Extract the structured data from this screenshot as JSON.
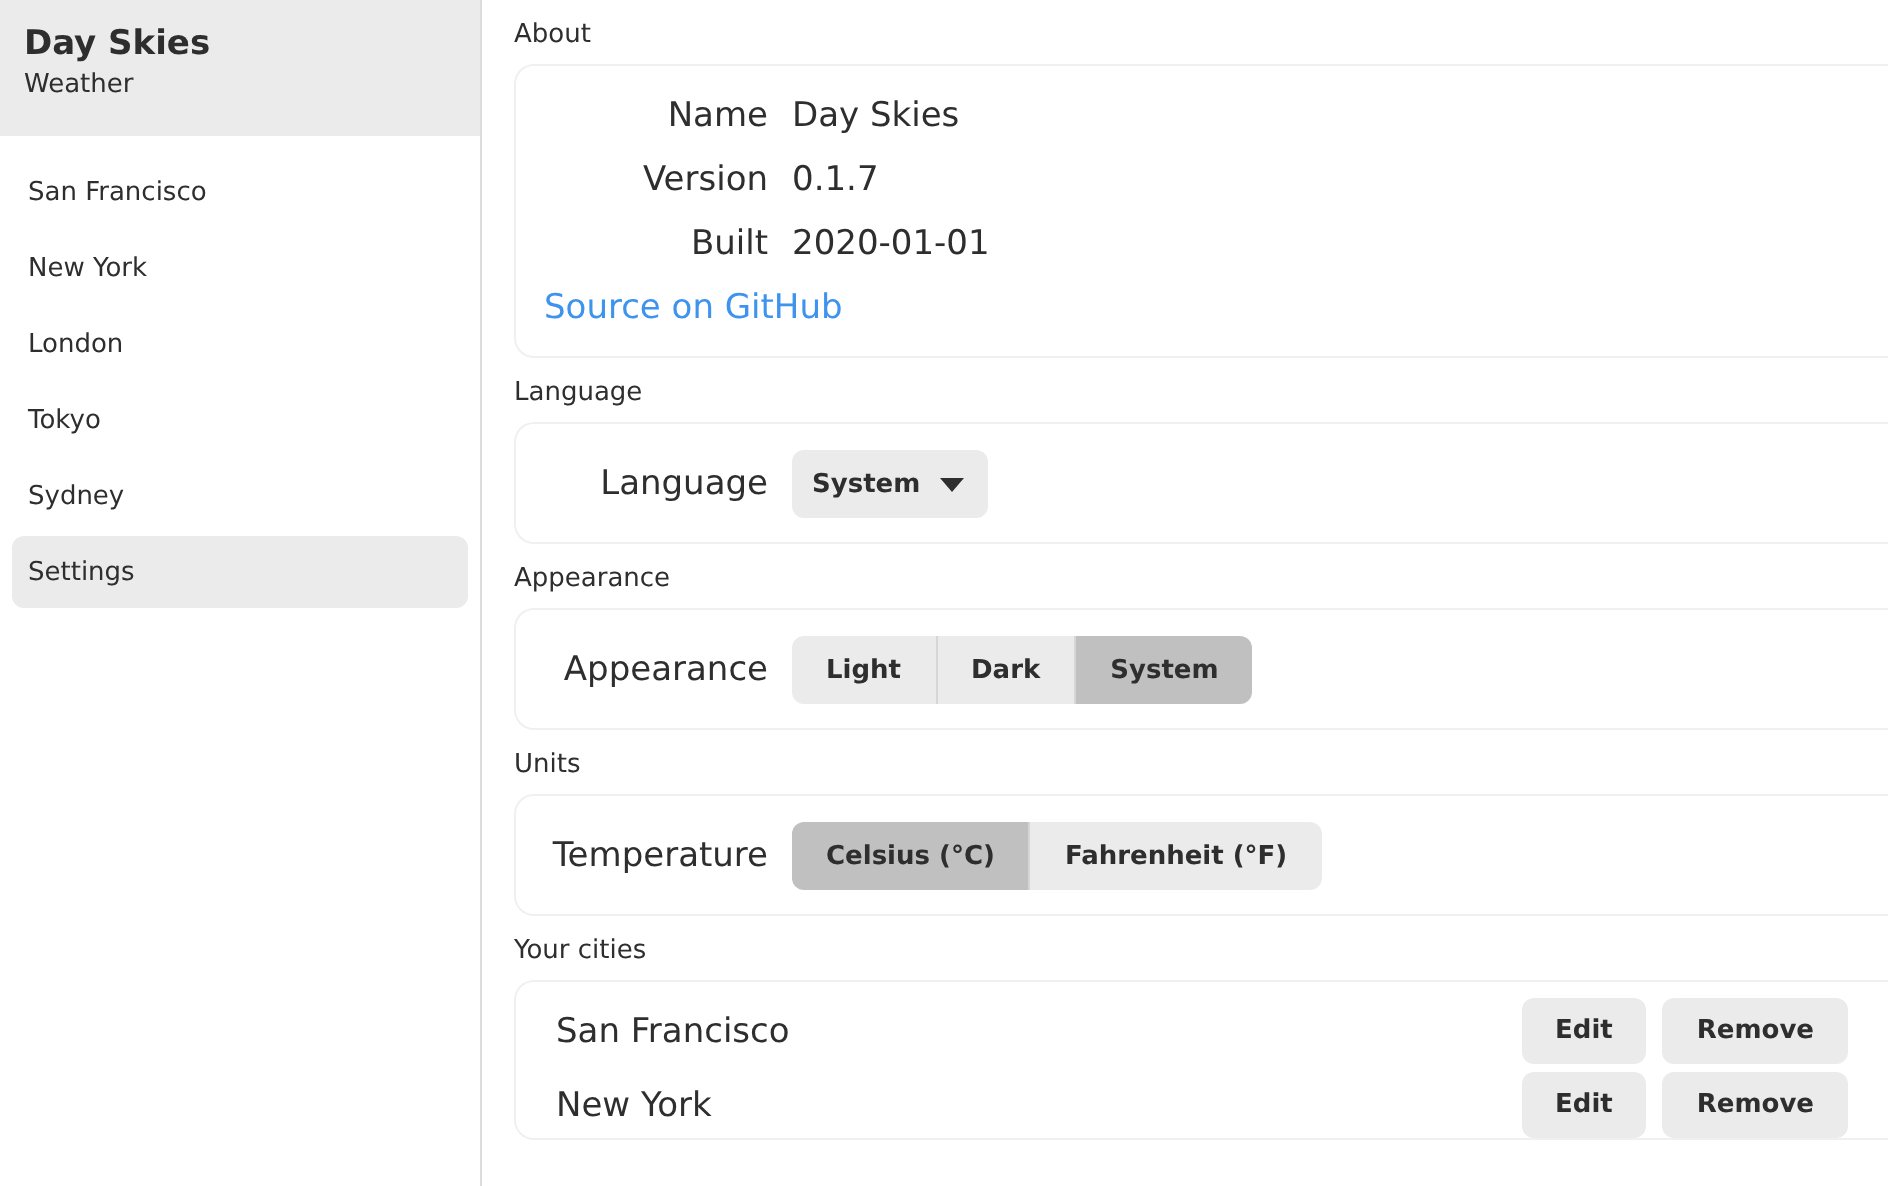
{
  "app": {
    "title": "Day Skies",
    "subtitle": "Weather"
  },
  "sidebar": {
    "items": [
      {
        "label": "San Francisco",
        "selected": false
      },
      {
        "label": "New York",
        "selected": false
      },
      {
        "label": "London",
        "selected": false
      },
      {
        "label": "Tokyo",
        "selected": false
      },
      {
        "label": "Sydney",
        "selected": false
      },
      {
        "label": "Settings",
        "selected": true
      }
    ]
  },
  "sections": [
    {
      "kind": "about",
      "title": "About",
      "rows": [
        {
          "label": "Name",
          "value": "Day Skies"
        },
        {
          "label": "Version",
          "value": "0.1.7"
        },
        {
          "label": "Built",
          "value": "2020-01-01"
        }
      ],
      "link": "Source on GitHub"
    },
    {
      "kind": "dropdown",
      "title": "Language",
      "label": "Language",
      "value": "System"
    },
    {
      "kind": "segmented",
      "title": "Appearance",
      "label": "Appearance",
      "options": [
        {
          "label": "Light",
          "selected": false
        },
        {
          "label": "Dark",
          "selected": false
        },
        {
          "label": "System",
          "selected": true
        }
      ]
    },
    {
      "kind": "segmented",
      "title": "Units",
      "label": "Temperature",
      "options": [
        {
          "label": "Celsius (°C)",
          "selected": true
        },
        {
          "label": "Fahrenheit (°F)",
          "selected": false
        }
      ]
    },
    {
      "kind": "cities",
      "title": "Your cities",
      "cities": [
        {
          "name": "San Francisco",
          "buttons": [
            "Edit",
            "Remove"
          ]
        },
        {
          "name": "New York",
          "buttons": [
            "Edit",
            "Remove"
          ]
        }
      ]
    }
  ]
}
